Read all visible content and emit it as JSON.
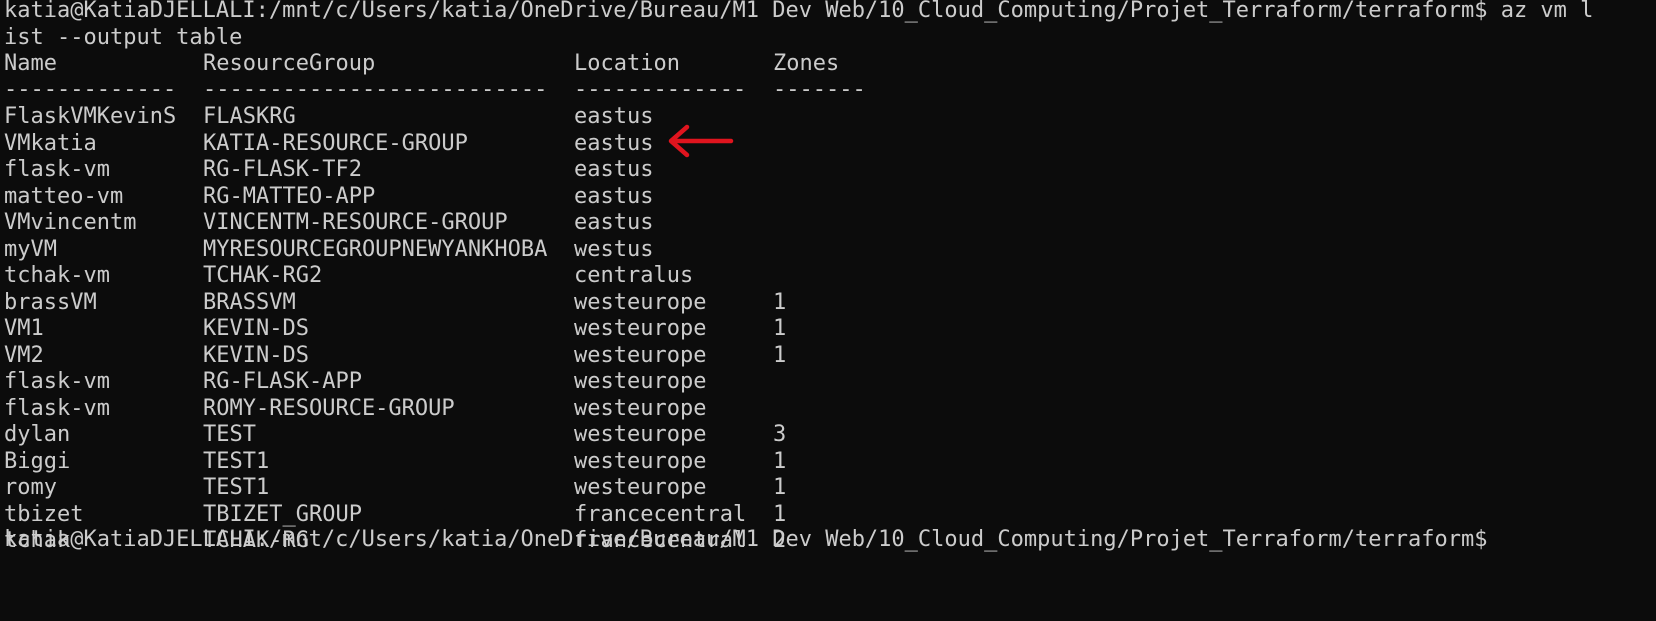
{
  "terminal": {
    "prompt_line": "katia@KatiaDJELLALI:/mnt/c/Users/katia/OneDrive/Bureau/M1 Dev Web/10_Cloud_Computing/Projet_Terraform/terraform$ az vm l",
    "command_wrap": "ist --output table",
    "final_prompt": "katia@KatiaDJELLALI:/mnt/c/Users/katia/OneDrive/Bureau/M1 Dev Web/10_Cloud_Computing/Projet_Terraform/terraform$"
  },
  "table": {
    "headers": [
      "Name",
      "ResourceGroup",
      "Location",
      "Zones"
    ],
    "separators": [
      "-------------",
      "--------------------------",
      "-------------",
      "-------"
    ],
    "rows": [
      [
        "FlaskVMKevinS",
        "FLASKRG",
        "eastus",
        ""
      ],
      [
        "VMkatia",
        "KATIA-RESOURCE-GROUP",
        "eastus",
        ""
      ],
      [
        "flask-vm",
        "RG-FLASK-TF2",
        "eastus",
        ""
      ],
      [
        "matteo-vm",
        "RG-MATTEO-APP",
        "eastus",
        ""
      ],
      [
        "VMvincentm",
        "VINCENTM-RESOURCE-GROUP",
        "eastus",
        ""
      ],
      [
        "myVM",
        "MYRESOURCEGROUPNEWYANKHOBA",
        "westus",
        ""
      ],
      [
        "tchak-vm",
        "TCHAK-RG2",
        "centralus",
        ""
      ],
      [
        "brassVM",
        "BRASSVM",
        "westeurope",
        "1"
      ],
      [
        "VM1",
        "KEVIN-DS",
        "westeurope",
        "1"
      ],
      [
        "VM2",
        "KEVIN-DS",
        "westeurope",
        "1"
      ],
      [
        "flask-vm",
        "RG-FLASK-APP",
        "westeurope",
        ""
      ],
      [
        "flask-vm",
        "ROMY-RESOURCE-GROUP",
        "westeurope",
        ""
      ],
      [
        "dylan",
        "TEST",
        "westeurope",
        "3"
      ],
      [
        "Biggi",
        "TEST1",
        "westeurope",
        "1"
      ],
      [
        "romy",
        "TEST1",
        "westeurope",
        "1"
      ],
      [
        "tbizet",
        "TBIZET_GROUP",
        "francecentral",
        "1"
      ],
      [
        "tchak",
        "TCHAK-RG",
        "francecentral",
        "2"
      ]
    ]
  },
  "annotation": {
    "arrow_icon": "red-arrow-left-icon",
    "arrow_color": "#e0141e"
  },
  "colors": {
    "background": "#0c0c0c",
    "text": "#cccccc"
  }
}
